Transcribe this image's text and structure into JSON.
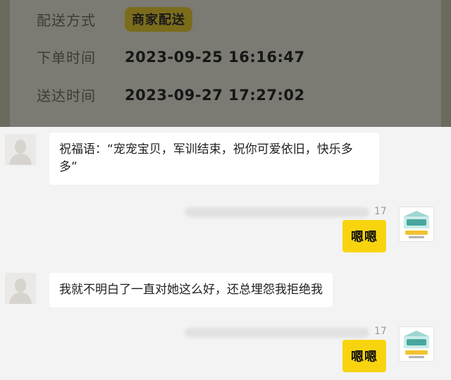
{
  "order": {
    "delivery_label": "配送方式",
    "delivery_value": "商家配送",
    "order_time_label": "下单时间",
    "order_time_value": "2023-09-25 16:16:47",
    "arrival_label": "送达时间",
    "arrival_value": "2023-09-27 17:27:02"
  },
  "chat": {
    "messages": [
      {
        "side": "left",
        "avatar_icon": "user-silhouette-icon",
        "text": "祝福语：“宠宠宝贝，军训结束，祝你可爱依旧，快乐多多”"
      },
      {
        "side": "right",
        "count": "17",
        "avatar_icon": "shop-logo-icon",
        "text": "嗯嗯"
      },
      {
        "side": "left",
        "avatar_icon": "user-silhouette-icon",
        "text": "我就不明白了一直对她这么好，还总埋怨我拒绝我"
      },
      {
        "side": "right",
        "count": "17",
        "avatar_icon": "shop-logo-icon",
        "text": "嗯嗯"
      }
    ]
  },
  "colors": {
    "accent_yellow": "#f8d40f",
    "overlay_dark": "#7b7a73",
    "bubble_white": "#ffffff",
    "chat_background": "#f3f3f3"
  }
}
